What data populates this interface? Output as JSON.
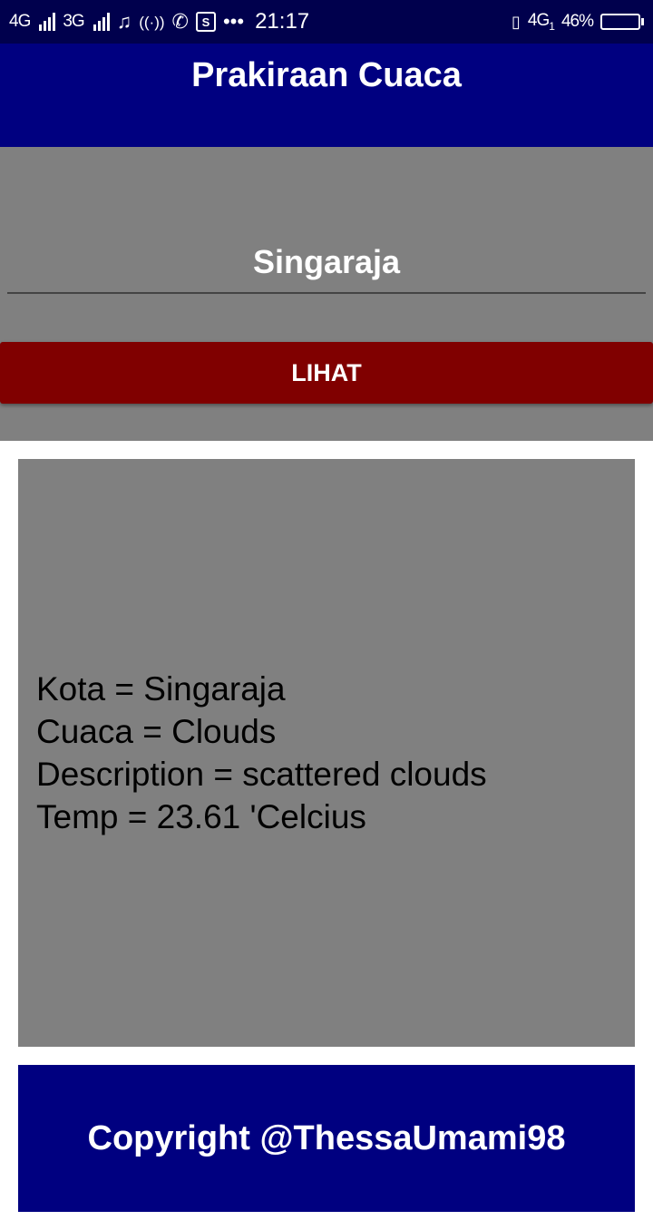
{
  "status_bar": {
    "network1": "4G",
    "network2": "3G",
    "time": "21:17",
    "network3": "4G",
    "network3_sub": "1",
    "battery": "46%",
    "battery_level": 0.46,
    "icons": [
      "music-note-icon",
      "hotspot-icon",
      "whatsapp-icon",
      "s-app-icon",
      "more-dots-icon",
      "vibrate-icon"
    ]
  },
  "app_bar": {
    "title": "Prakiraan Cuaca"
  },
  "search": {
    "city_value": "Singaraja",
    "button_label": "LIHAT"
  },
  "result": {
    "lines": [
      "Kota = Singaraja",
      "Cuaca = Clouds",
      "Description = scattered clouds",
      "Temp = 23.61 'Celcius"
    ]
  },
  "footer": {
    "copyright": "Copyright @ThessaUmami98"
  },
  "colors": {
    "status_bar": "#00004d",
    "app_bar": "#000080",
    "panel": "#808080",
    "button": "#800000",
    "footer": "#000080"
  }
}
